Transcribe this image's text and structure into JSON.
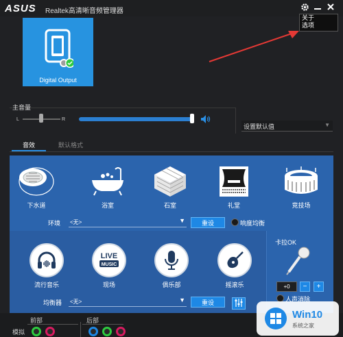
{
  "titlebar": {
    "logo": "ASUS",
    "title": "Realtek高清晰音频管理器"
  },
  "popup_menu": {
    "items": [
      "关于",
      "选项"
    ]
  },
  "device": {
    "label": "Digital Output"
  },
  "master_volume": {
    "label": "主音量",
    "left": "L",
    "right": "R",
    "volume_level": 1.0,
    "balance_level": 0.5
  },
  "default_device": {
    "label": "设置默认值"
  },
  "tabs": [
    {
      "label": "音效",
      "active": true
    },
    {
      "label": "默认格式",
      "active": false
    }
  ],
  "environment": {
    "items": [
      {
        "label": "下水道",
        "icon": "sewer-icon"
      },
      {
        "label": "浴室",
        "icon": "bathtub-icon"
      },
      {
        "label": "石室",
        "icon": "stone-room-icon"
      },
      {
        "label": "礼堂",
        "icon": "auditorium-icon"
      },
      {
        "label": "竞技场",
        "icon": "arena-icon"
      }
    ],
    "row_label": "环境",
    "select_value": "<无>",
    "reset_label": "重设",
    "loudness_label": "响度均衡"
  },
  "equalizer": {
    "items": [
      {
        "label": "流行音乐",
        "icon": "headphones-icon"
      },
      {
        "label": "现场",
        "icon": "live-music-icon"
      },
      {
        "label": "俱乐部",
        "icon": "microphone-icon"
      },
      {
        "label": "摇滚乐",
        "icon": "guitar-icon"
      }
    ],
    "row_label": "均衡器",
    "select_value": "<无>",
    "reset_label": "重设"
  },
  "karaoke": {
    "label": "卡拉OK",
    "value": "+0",
    "minus": "−",
    "plus": "+",
    "vocal_cancel": "人声消除"
  },
  "jacks": {
    "front_label": "前部",
    "rear_label": "后部",
    "analog_label": "模拟"
  },
  "watermark": {
    "text": "Win10",
    "sub": "系统之家"
  },
  "colors": {
    "accent": "#1e88e5",
    "panel": "#2b64ad"
  }
}
